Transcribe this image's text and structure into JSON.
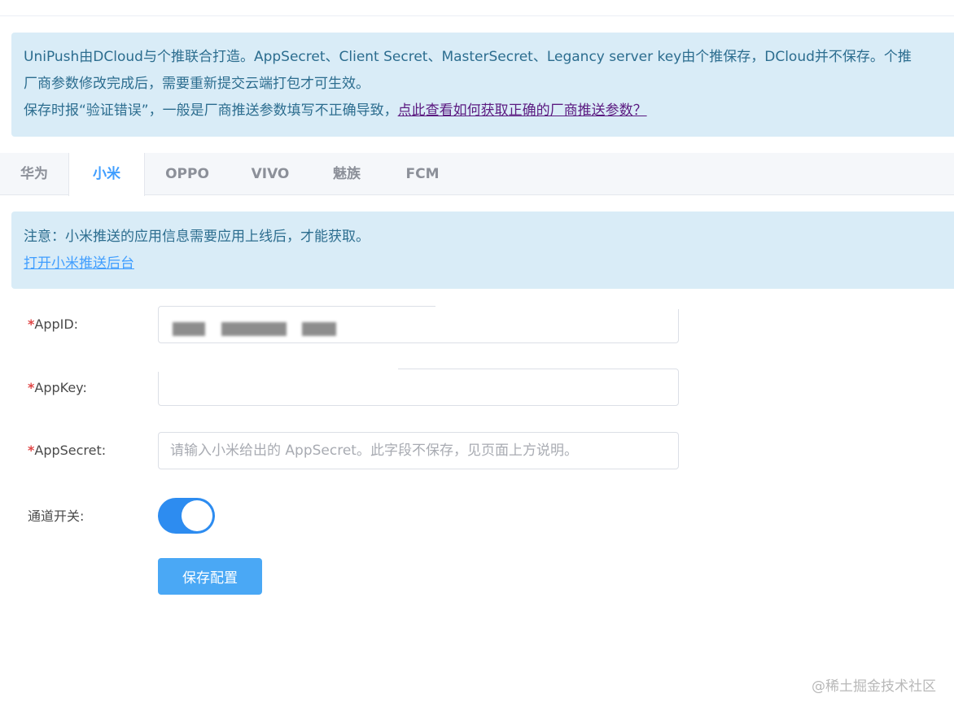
{
  "intro": {
    "line1": "UniPush由DCloud与个推联合打造。AppSecret、Client Secret、MasterSecret、Legancy server key由个推保存，DCloud并不保存。个推",
    "line2": "厂商参数修改完成后，需要重新提交云端打包才可生效。",
    "line3_prefix": "保存时报“验证错误”，一般是厂商推送参数填写不正确导致，",
    "line3_link": "点此查看如何获取正确的厂商推送参数？"
  },
  "tabs": [
    "华为",
    "小米",
    "OPPO",
    "VIVO",
    "魅族",
    "FCM"
  ],
  "active_tab": "小米",
  "notice": {
    "text": "注意：小米推送的应用信息需要应用上线后，才能获取。",
    "link": "打开小米推送后台"
  },
  "form": {
    "required_mark": "*",
    "appid_label": "AppID:",
    "appkey_label": "AppKey:",
    "appsecret_label": "AppSecret:",
    "appsecret_placeholder": "请输入小米给出的 AppSecret。此字段不保存，见页面上方说明。",
    "switch_label": "通道开关:",
    "switch_on": true,
    "save_label": "保存配置"
  },
  "watermark": "@稀土掘金技术社区",
  "colors": {
    "accent": "#409eff",
    "info_bg": "#d9ecf7",
    "switch_on": "#2d8cf0",
    "button": "#4aa8f5",
    "required": "#e04646"
  }
}
